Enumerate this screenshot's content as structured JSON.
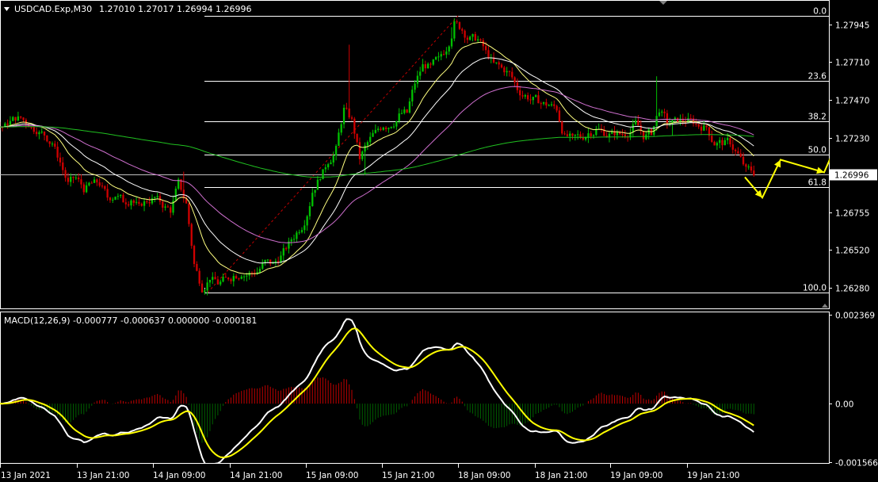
{
  "header": {
    "symbol_tf": "USDCAD.Exp,M30",
    "ohlc": "1.27010 1.27017 1.26994 1.26996"
  },
  "macd_header": "MACD(12,26,9) -0.000777 -0.000637 0.000000 -0.000181",
  "colors": {
    "background": "#000000",
    "axis": "#ffffff",
    "bull": "#00c000",
    "bear": "#d00000",
    "ma_fast": "#ffff80",
    "ma_mid": "#ffffff",
    "ma_slow": "#d070d0",
    "ma_long": "#20c020",
    "fib": "#ffffff",
    "trend": "#c00000",
    "forecast": "#ffff00",
    "macd_main": "#ffffff",
    "macd_signal": "#ffff00",
    "hist_pos": "#c00000",
    "hist_neg": "#006000"
  },
  "chart_data": [
    {
      "type": "candlestick",
      "panel": "price",
      "symbol": "USDCAD.Exp",
      "timeframe": "M30",
      "ylim": [
        1.2615,
        1.281
      ],
      "y_ticks": [
        "1.27945",
        "1.27710",
        "1.27470",
        "1.27230",
        "1.26755",
        "1.26520",
        "1.26280"
      ],
      "current_price": "1.26996",
      "x_ticks": [
        "13 Jan 2021",
        "13 Jan 21:00",
        "14 Jan 09:00",
        "14 Jan 21:00",
        "15 Jan 09:00",
        "15 Jan 21:00",
        "18 Jan 09:00",
        "18 Jan 21:00",
        "19 Jan 09:00",
        "19 Jan 21:00"
      ],
      "close_path": [
        [
          0,
          1.273
        ],
        [
          2,
          1.2738
        ],
        [
          4,
          1.2728
        ],
        [
          6,
          1.2722
        ],
        [
          7,
          1.2705
        ],
        [
          8,
          1.2693
        ],
        [
          9,
          1.2698
        ],
        [
          10,
          1.2692
        ],
        [
          12,
          1.2693
        ],
        [
          13,
          1.2688
        ],
        [
          15,
          1.2685
        ],
        [
          17,
          1.2681
        ],
        [
          19,
          1.2685
        ],
        [
          21,
          1.268
        ],
        [
          22,
          1.2692
        ],
        [
          23,
          1.2678
        ],
        [
          24,
          1.2645
        ],
        [
          25,
          1.2628
        ],
        [
          26,
          1.2632
        ],
        [
          28,
          1.2634
        ],
        [
          30,
          1.2636
        ],
        [
          32,
          1.264
        ],
        [
          34,
          1.2643
        ],
        [
          36,
          1.2655
        ],
        [
          38,
          1.2672
        ],
        [
          39,
          1.2687
        ],
        [
          40,
          1.27
        ],
        [
          42,
          1.2718
        ],
        [
          43,
          1.2738
        ],
        [
          44,
          1.2735
        ],
        [
          45,
          1.2708
        ],
        [
          46,
          1.272
        ],
        [
          47,
          1.2728
        ],
        [
          49,
          1.2732
        ],
        [
          51,
          1.2738
        ],
        [
          52,
          1.276
        ],
        [
          53,
          1.277
        ],
        [
          54,
          1.2768
        ],
        [
          56,
          1.2782
        ],
        [
          57,
          1.2795
        ],
        [
          58,
          1.279
        ],
        [
          59,
          1.2784
        ],
        [
          60,
          1.2782
        ],
        [
          61,
          1.2778
        ],
        [
          62,
          1.277
        ],
        [
          64,
          1.2764
        ],
        [
          65,
          1.2752
        ],
        [
          67,
          1.2747
        ],
        [
          69,
          1.2745
        ],
        [
          70,
          1.274
        ],
        [
          71,
          1.2725
        ],
        [
          73,
          1.2722
        ],
        [
          75,
          1.2725
        ],
        [
          77,
          1.2723
        ],
        [
          79,
          1.2725
        ],
        [
          80,
          1.2732
        ],
        [
          81,
          1.2727
        ],
        [
          82,
          1.2728
        ],
        [
          83,
          1.2742
        ],
        [
          84,
          1.2735
        ],
        [
          86,
          1.2733
        ],
        [
          88,
          1.2732
        ],
        [
          90,
          1.2722
        ],
        [
          92,
          1.272
        ],
        [
          94,
          1.2705
        ],
        [
          95,
          1.2698
        ]
      ],
      "moving_averages": [
        {
          "role": "fast",
          "period_hint": 5
        },
        {
          "role": "mid",
          "period_hint": 10
        },
        {
          "role": "slow",
          "period_hint": 21
        },
        {
          "role": "long",
          "period_hint": 100
        }
      ],
      "fibonacci": {
        "levels": [
          "0.0",
          "23.6",
          "38.2",
          "50.0",
          "61.8",
          "100.0"
        ],
        "high": 1.28,
        "low": 1.2625
      },
      "forecast_path": [
        [
          1.2698
        ],
        [
          1.2685
        ],
        [
          1.2709
        ],
        [
          1.2701
        ],
        [
          1.275
        ]
      ]
    },
    {
      "type": "line",
      "panel": "macd",
      "title": "MACD(12,26,9)",
      "ylim": [
        -0.0016,
        0.00245
      ],
      "y_ticks": [
        "0.002369",
        "0.00",
        "-0.001566"
      ],
      "series": [
        {
          "name": "MACD",
          "role": "main"
        },
        {
          "name": "Signal",
          "role": "signal"
        },
        {
          "name": "Histogram",
          "role": "histogram"
        }
      ]
    }
  ]
}
